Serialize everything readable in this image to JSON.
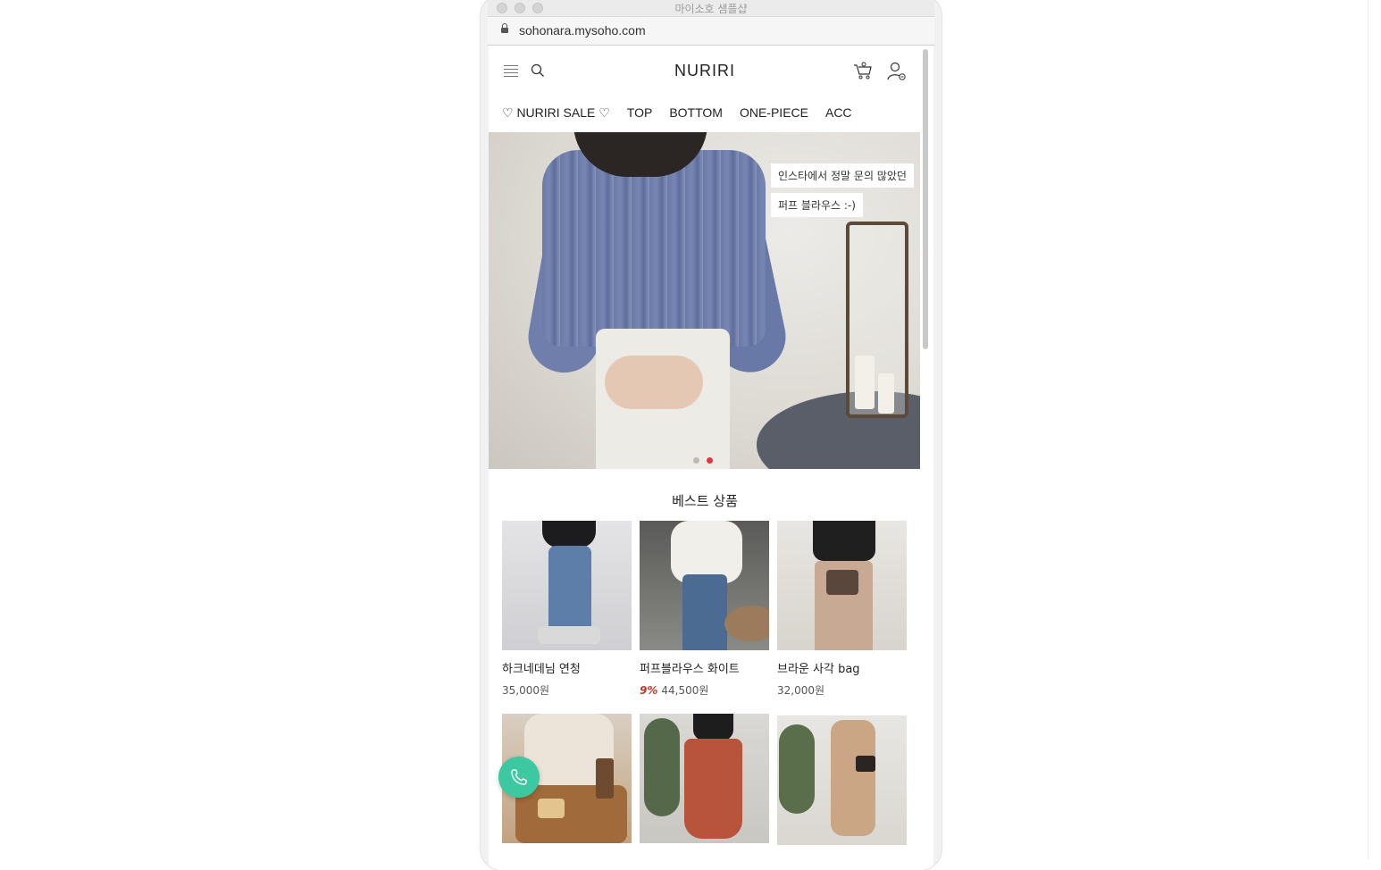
{
  "window": {
    "title": "마이소호 샘플샵"
  },
  "address_bar": {
    "url": "sohonara.mysoho.com"
  },
  "header": {
    "logo_text": "NURIRI"
  },
  "nav": {
    "items": [
      "♡ NURIRI SALE ♡",
      "TOP",
      "BOTTOM",
      "ONE-PIECE",
      "ACC"
    ]
  },
  "hero": {
    "caption_line1": "인스타에서 정말 문의 많았던",
    "caption_line2": "퍼프 블라우스 :-)",
    "active_slide": 2,
    "slide_count": 2
  },
  "best_products": {
    "title": "베스트 상품",
    "items": [
      {
        "name": "하크네데님 연청",
        "price": "35,000원",
        "discount": ""
      },
      {
        "name": "퍼프블라우스 화이트",
        "price": "44,500원",
        "discount": "9%"
      },
      {
        "name": "브라운 사각 bag",
        "price": "32,000원",
        "discount": ""
      }
    ]
  },
  "colors": {
    "call_button": "#3cc8a0",
    "discount": "#c0392b",
    "active_dot": "#e3343c"
  }
}
